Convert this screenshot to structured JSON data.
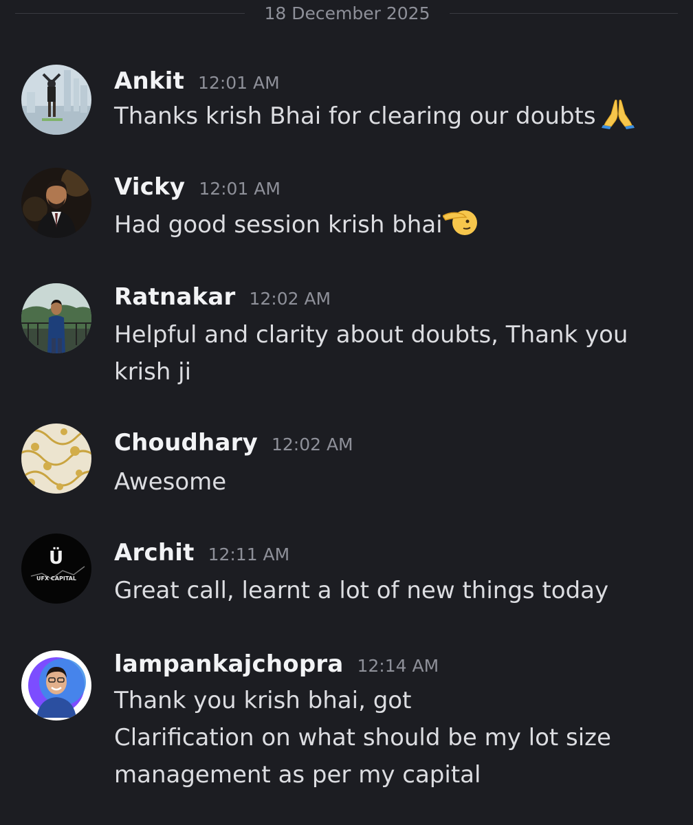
{
  "date_divider": "18 December 2025",
  "messages": [
    {
      "username": "Ankit",
      "time": "12:01 AM",
      "lines": [
        "Thanks krish Bhai for clearing our doubts"
      ],
      "emoji": "folded-hands"
    },
    {
      "username": "Vicky",
      "time": "12:01 AM",
      "lines": [
        "Had good session krish bhai"
      ],
      "emoji": "saluting-face"
    },
    {
      "username": "Ratnakar",
      "time": "12:02 AM",
      "lines": [
        "Helpful and clarity about doubts, Thank you",
        "krish ji"
      ]
    },
    {
      "username": "Choudhary",
      "time": "12:02 AM",
      "lines": [
        "Awesome"
      ]
    },
    {
      "username": "Archit",
      "time": "12:11 AM",
      "lines": [
        "Great call, learnt a lot of new things today"
      ],
      "avatar_text": "UFX CAPITAL"
    },
    {
      "username": "lampankajchopra",
      "time": "12:14 AM",
      "lines": [
        "Thank you krish bhai, got",
        "Clarification on what should be my lot size",
        "management as per my capital"
      ]
    }
  ],
  "colors": {
    "background": "#1c1d22",
    "username": "#f2f3f5",
    "message_text": "#dcdde1",
    "timestamp": "#8e9099"
  }
}
